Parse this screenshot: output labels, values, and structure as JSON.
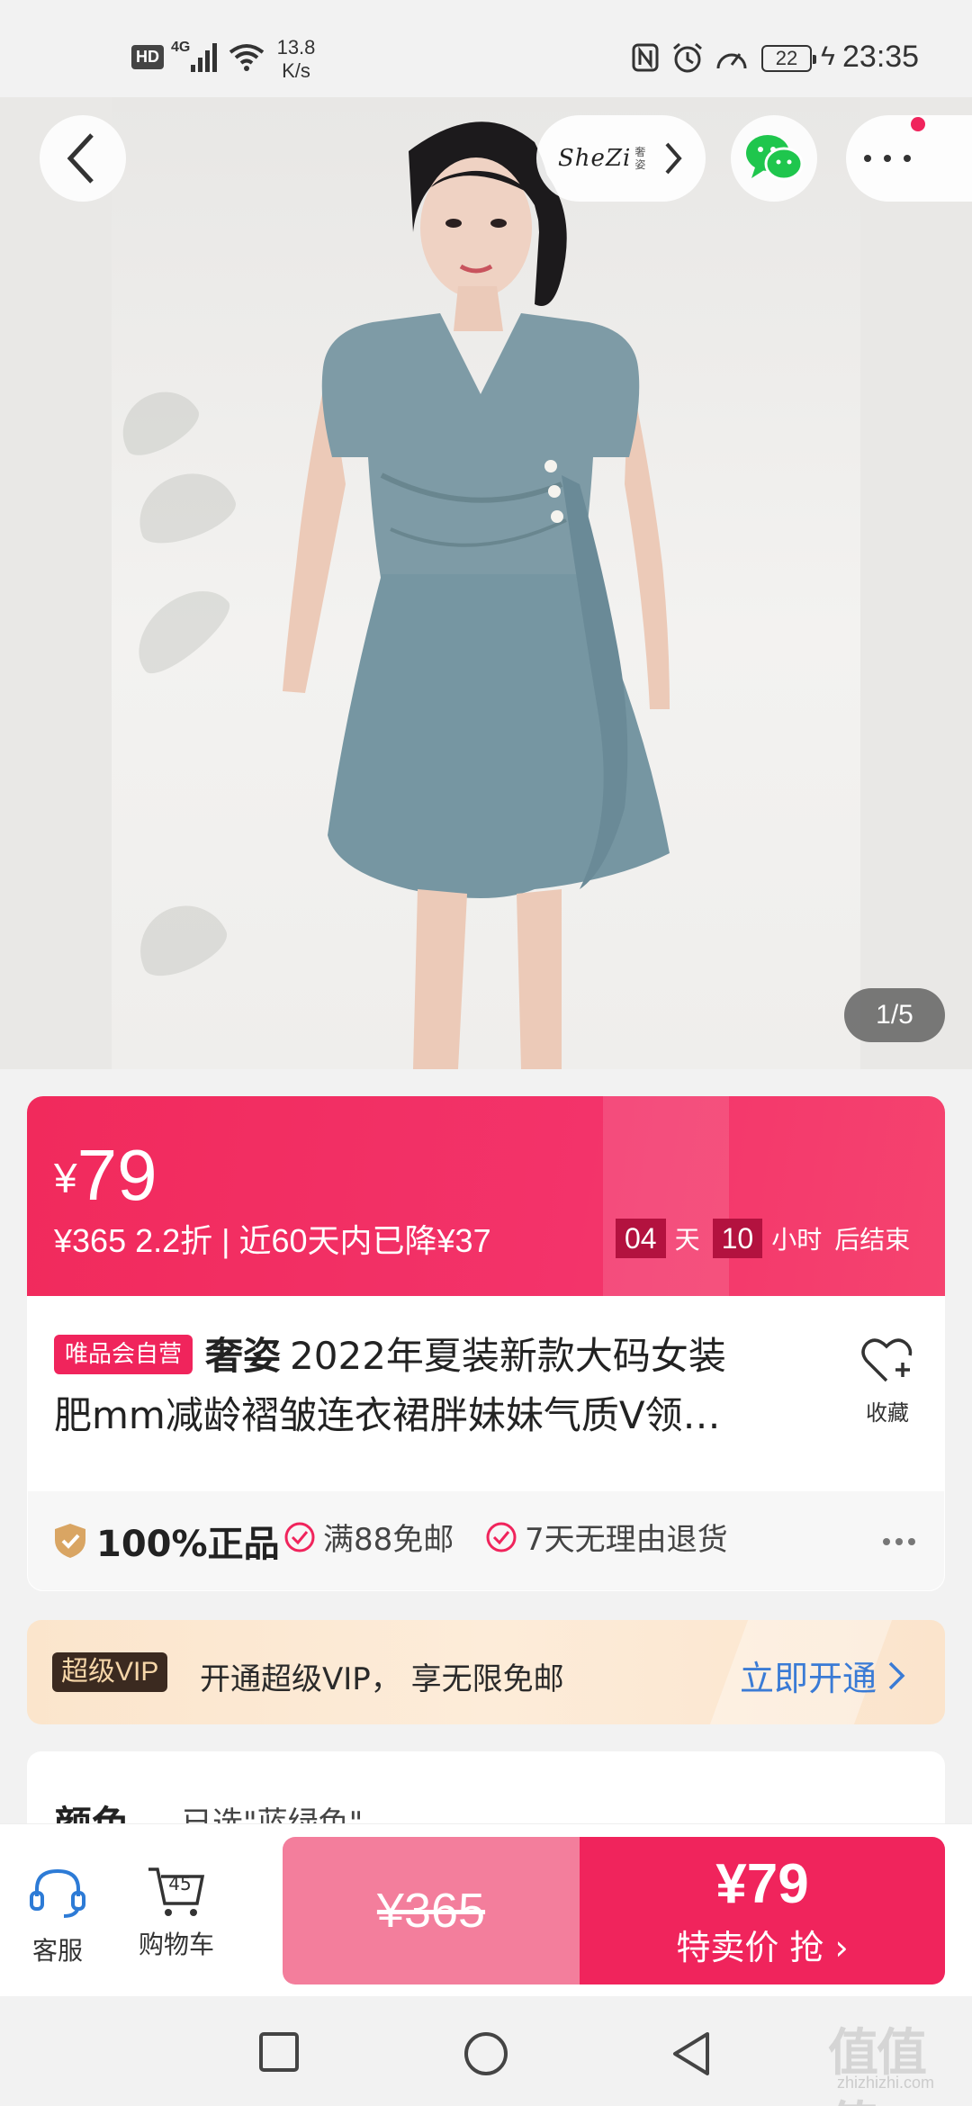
{
  "status_bar": {
    "hd": "HD",
    "network": "4G",
    "speed_value": "13.8",
    "speed_unit": "K/s",
    "battery": "22",
    "time": "23:35"
  },
  "hero": {
    "brand_logo": "SheZi",
    "brand_logo_cn": "奢姿",
    "page_counter": "1/5"
  },
  "price": {
    "currency": "¥",
    "current": "79",
    "sub_line": "¥365  2.2折 | 近60天内已降¥37",
    "countdown_days": "04",
    "countdown_days_unit": "天",
    "countdown_hours": "10",
    "countdown_hours_unit": "小时",
    "countdown_suffix": "后结束",
    "accent_color": "#f0245c"
  },
  "product": {
    "badge": "唯品会自营",
    "brand": "奢姿",
    "title_line1_rest": "2022年夏装新款大码女装",
    "title_line2": "肥mm减龄褶皱连衣裙胖妹妹气质V领…",
    "favorite_label": "收藏"
  },
  "guarantees": {
    "authentic": "100%正品",
    "free_shipping": "满88免邮",
    "returns": "7天无理由退货"
  },
  "vip": {
    "tag": "超级VIP",
    "text": "开通超级VIP， 享无限免邮",
    "cta": "立即开通"
  },
  "spec": {
    "label": "颜色",
    "value": "已选\"蓝绿色\""
  },
  "bottom_bar": {
    "service_label": "客服",
    "cart_label": "购物车",
    "cart_count": "45",
    "original_price": "¥365",
    "sale_price": "¥79",
    "buy_label": "特卖价 抢"
  },
  "watermark": {
    "main": "值值值",
    "sub": "zhizhizhi.com"
  },
  "icons": [
    "hd-badge",
    "signal-icon",
    "wifi-icon",
    "nfc-icon",
    "alarm-icon",
    "meter-icon",
    "battery-icon",
    "charging-icon",
    "back-icon",
    "chevron-right-icon",
    "wechat-icon",
    "more-icon",
    "heart-plus-icon",
    "shield-icon",
    "check-circle-icon",
    "headset-icon",
    "cart-icon",
    "square-nav-icon",
    "circle-nav-icon",
    "triangle-back-icon"
  ]
}
